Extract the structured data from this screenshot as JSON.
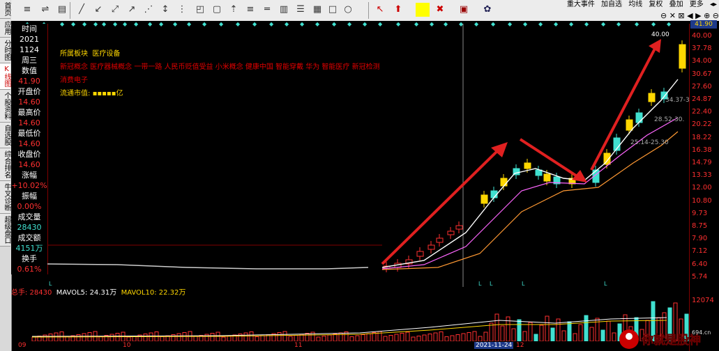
{
  "left_nav": [
    "首页",
    "应用",
    "分时图",
    "K线图",
    "个股资料",
    "自选股",
    "综合排名",
    "牛叉诊断",
    "超级盘口"
  ],
  "toolbar": {
    "icons": [
      "cursor-icon",
      "line-icon",
      "ray-icon",
      "arrow-line-icon",
      "arrow-icon",
      "dot-icon",
      "vertical-line-icon",
      "rectangle-icon",
      "rect-corner-icon",
      "text-icon",
      "horizontal-icon",
      "grid-icon",
      "circle-icon"
    ],
    "right_menu": [
      "重大事件",
      "加自选",
      "均线",
      "复权",
      "叠加",
      "更多"
    ]
  },
  "data_panel": {
    "rows": [
      {
        "label": "时间",
        "value": "2021"
      },
      {
        "label": "",
        "value": "1124"
      },
      {
        "label": "周三",
        "value": ""
      },
      {
        "label": "数值",
        "value": "41.90"
      },
      {
        "label": "开盘价",
        "value": "14.60"
      },
      {
        "label": "最高价",
        "value": "14.60"
      },
      {
        "label": "最低价",
        "value": "14.60"
      },
      {
        "label": "收盘价",
        "value": "14.60"
      },
      {
        "label": "涨幅",
        "value": "+10.02%"
      },
      {
        "label": "振幅",
        "value": "0.00%"
      },
      {
        "label": "成交量",
        "value": "28430"
      },
      {
        "label": "成交额",
        "value": "4151万"
      },
      {
        "label": "换手",
        "value": "0.61%"
      }
    ]
  },
  "info": {
    "sector_label": "所属板块",
    "sector": "医疗设备",
    "concepts": "新冠概念  医疗器械概念  一带一路  人民币贬值受益  小米概念  健康中国  智能穿戴  华为  智能医疗  新冠检测",
    "concepts2": "消费电子",
    "market_cap_label": "流通市值:",
    "market_cap_value": "▪▪▪▪▪亿"
  },
  "price_axis": [
    "40.00",
    "37.78",
    "34.00",
    "30.67",
    "27.60",
    "24.87",
    "22.40",
    "20.22",
    "18.22",
    "16.38",
    "14.79",
    "13.33",
    "12.00",
    "10.80",
    "9.73",
    "8.75",
    "7.90",
    "7.12",
    "6.40",
    "5.74"
  ],
  "price_top_label": "41.90",
  "annotations": [
    "40.00",
    "34.37-3",
    "28.52-30.",
    "25.14-25.30"
  ],
  "volume": {
    "label_total": "总手: 28430",
    "mavol5": "MAVOL5: 24.31万",
    "mavol10": "MAVOL10: 22.32万",
    "axis_top": "12074"
  },
  "x_axis": [
    "09",
    "10",
    "11",
    "2021-11-24",
    "12"
  ],
  "watermark": "你就是股神",
  "colors": {
    "up": "#ffd700",
    "up_hollow": "#ff3030",
    "down": "#40e0d0",
    "ma5": "#ffffff",
    "ma10": "#ff66ff",
    "ma20": "#ff9933",
    "arrow": "#e02020"
  }
}
